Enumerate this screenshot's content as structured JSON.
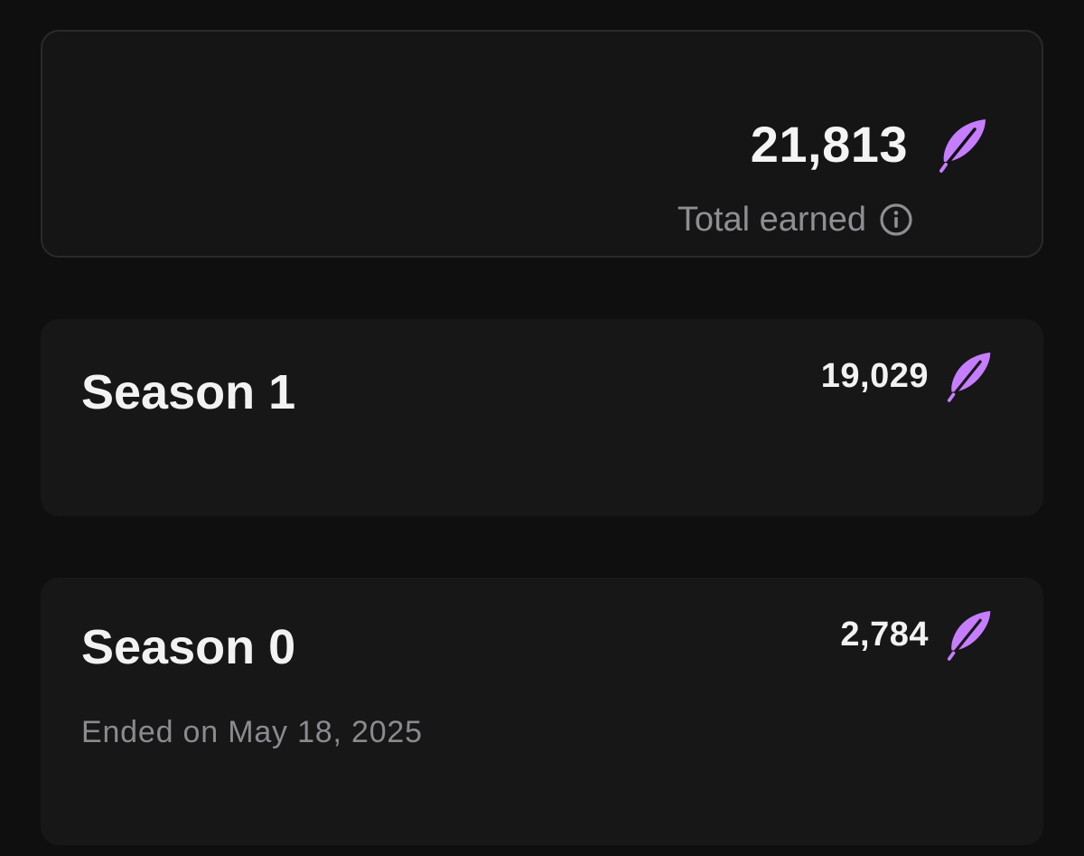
{
  "accent_color": "#c77dff",
  "total": {
    "value": "21,813",
    "label": "Total earned",
    "icons": [
      "feather-icon",
      "info-icon"
    ]
  },
  "seasons": [
    {
      "title": "Season 1",
      "points": "19,029",
      "icon": "feather-icon"
    },
    {
      "title": "Season 0",
      "points": "2,784",
      "ended": "Ended on May 18, 2025",
      "icon": "feather-icon"
    }
  ]
}
